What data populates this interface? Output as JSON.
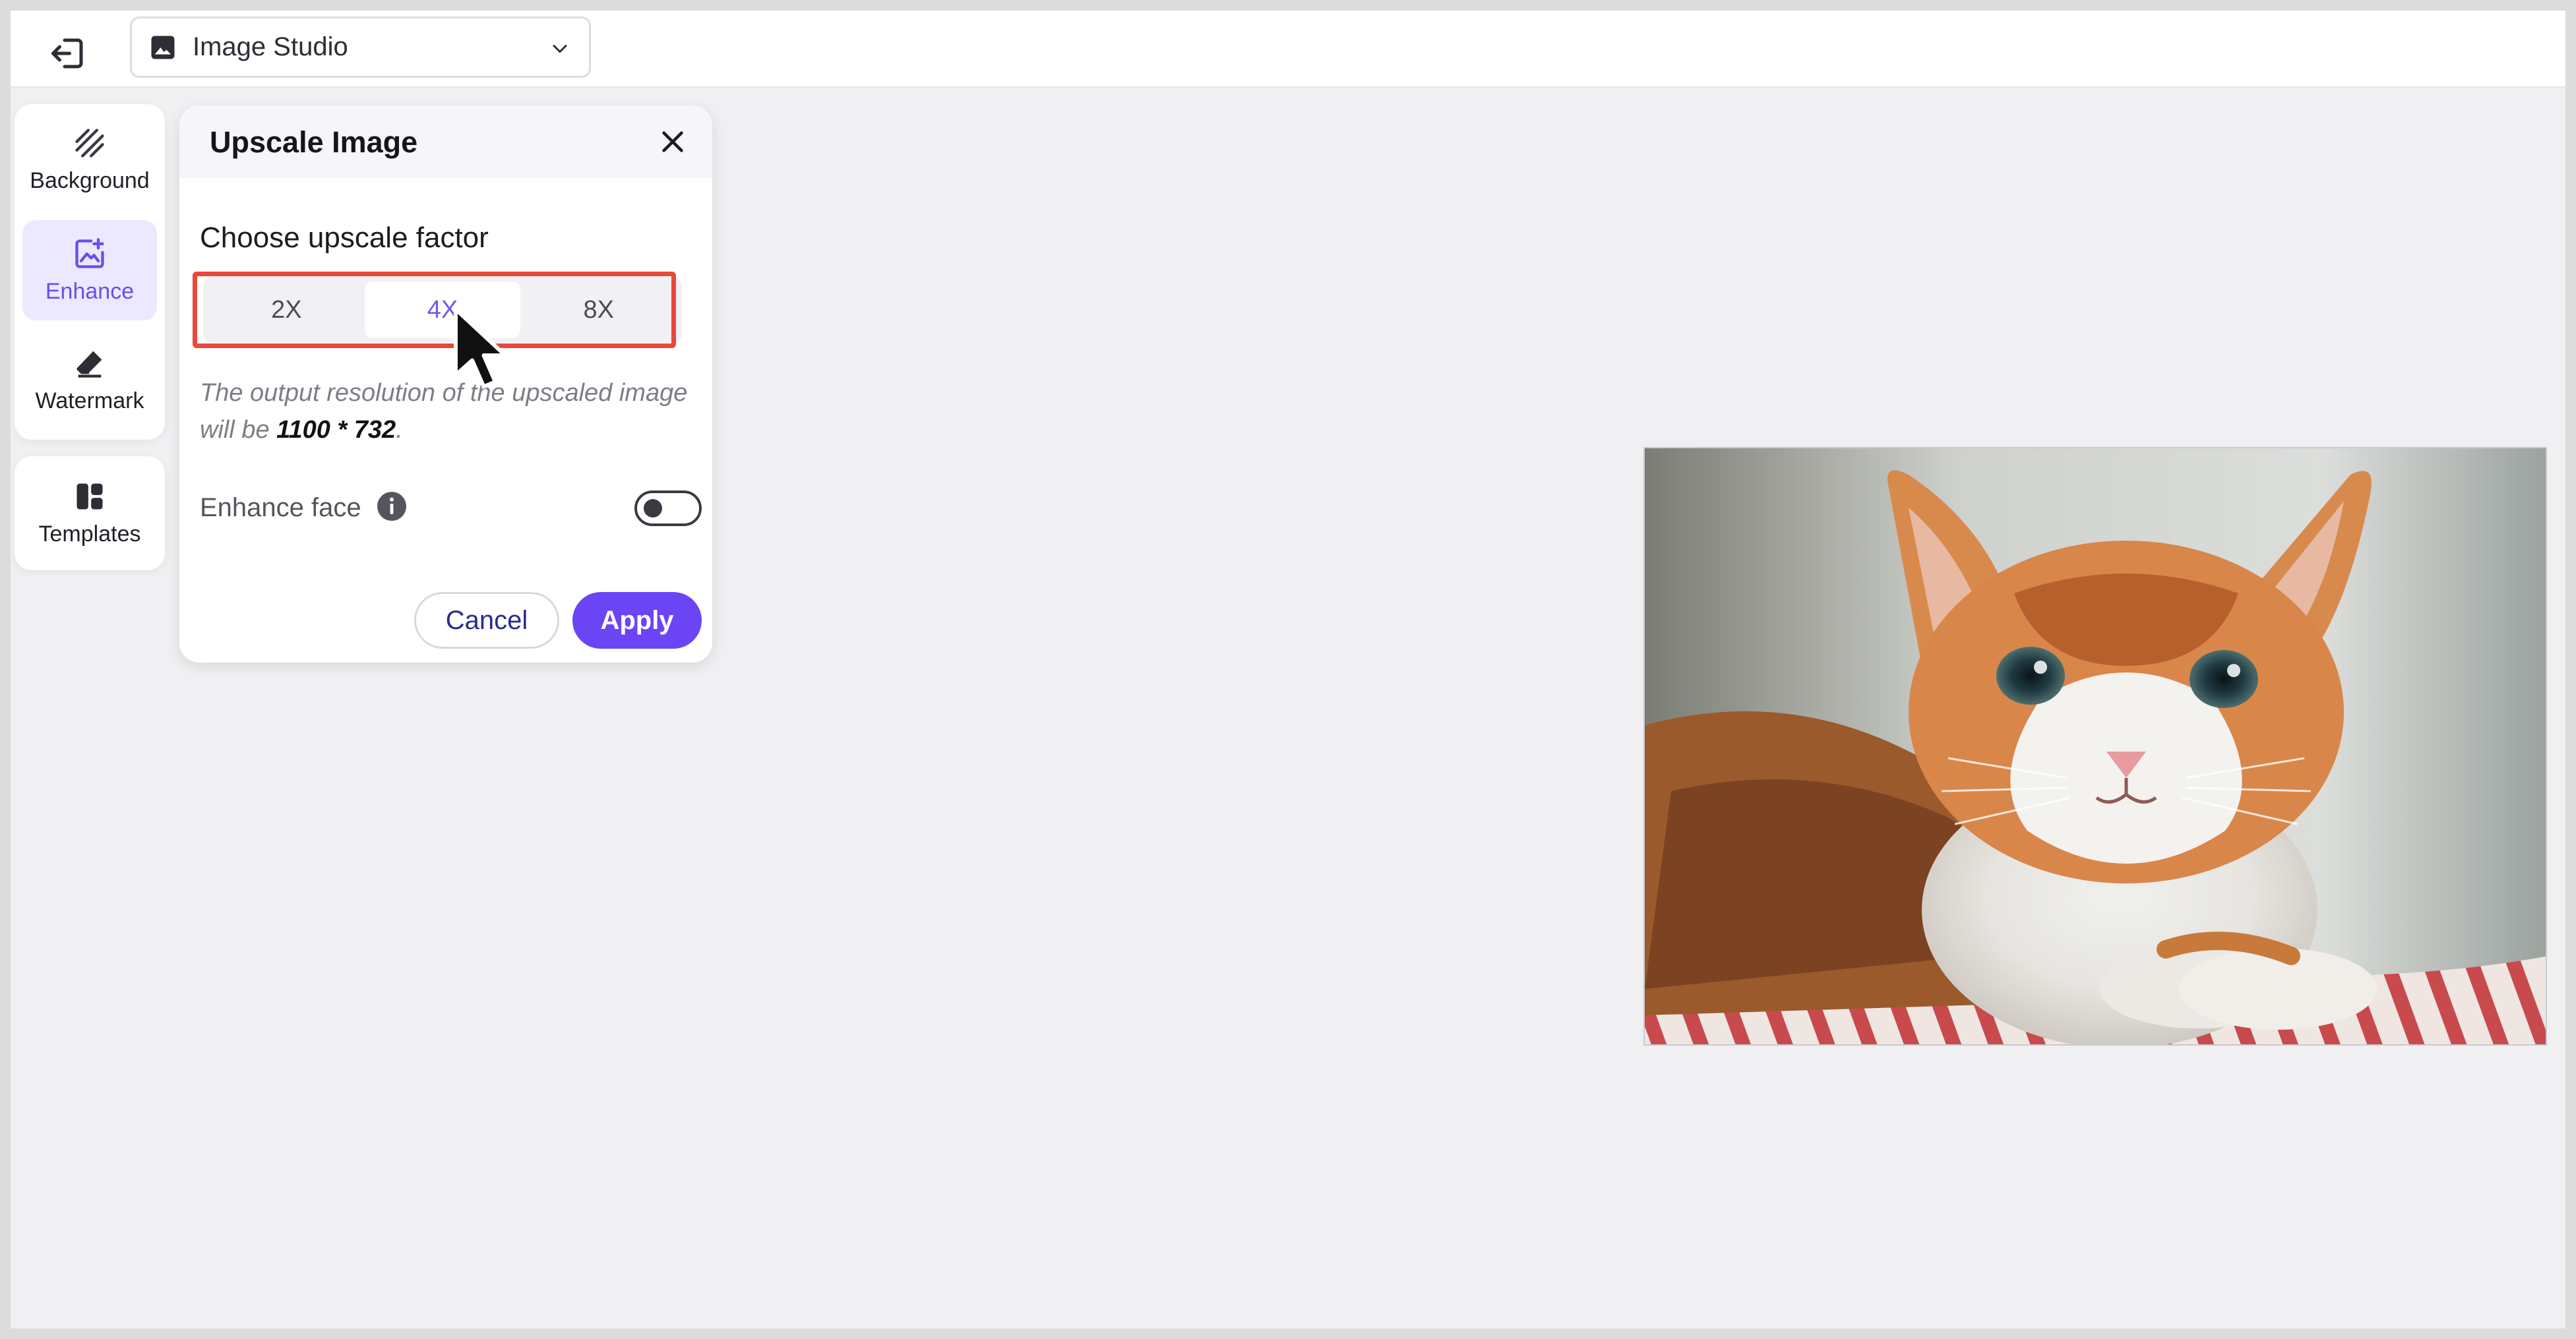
{
  "header": {
    "studio_label": "Image Studio"
  },
  "rail": {
    "items": [
      {
        "label": "Background",
        "icon": "background-icon",
        "active": false
      },
      {
        "label": "Enhance",
        "icon": "enhance-icon",
        "active": true
      },
      {
        "label": "Watermark",
        "icon": "eraser-icon",
        "active": false
      }
    ],
    "templates_label": "Templates"
  },
  "panel": {
    "title": "Upscale Image",
    "section_label": "Choose upscale factor",
    "factors": [
      "2X",
      "4X",
      "8X"
    ],
    "selected_factor": "4X",
    "hint_prefix": "The output resolution of the upscaled image will be ",
    "hint_resolution": "1100 * 732",
    "hint_suffix": ".",
    "enhance_face_label": "Enhance face",
    "enhance_face_on": false,
    "cancel_label": "Cancel",
    "apply_label": "Apply"
  },
  "colors": {
    "accent": "#6b45f5",
    "highlight": "#e8493b",
    "active_bg": "#ece8ff"
  }
}
